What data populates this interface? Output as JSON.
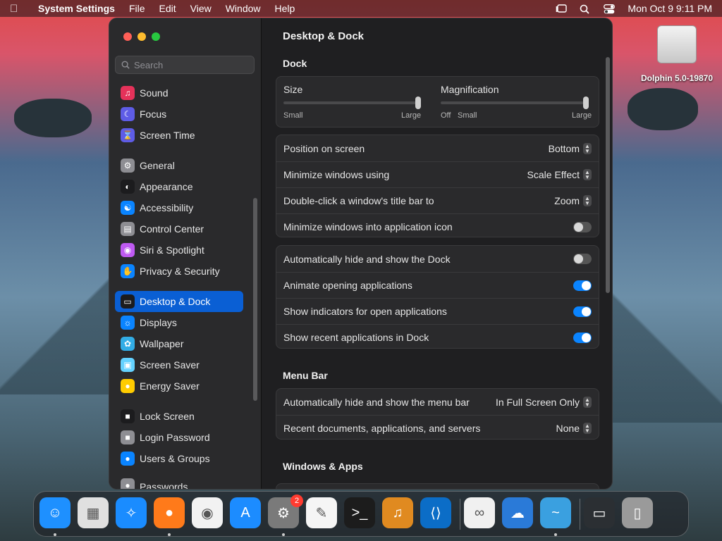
{
  "menubar": {
    "app_name": "System Settings",
    "menus": [
      "File",
      "Edit",
      "View",
      "Window",
      "Help"
    ],
    "clock": "Mon Oct 9  9:11 PM"
  },
  "desktop": {
    "drive_label": "Dolphin 5.0-19870"
  },
  "sidebar": {
    "search_placeholder": "Search",
    "items": [
      {
        "label": "Sound",
        "color": "#e5325a"
      },
      {
        "label": "Focus",
        "color": "#5e5ce6"
      },
      {
        "label": "Screen Time",
        "color": "#5e5ce6"
      },
      {
        "label": "General",
        "color": "#8e8e93"
      },
      {
        "label": "Appearance",
        "color": "#1c1c1e"
      },
      {
        "label": "Accessibility",
        "color": "#0a84ff"
      },
      {
        "label": "Control Center",
        "color": "#8e8e93"
      },
      {
        "label": "Siri & Spotlight",
        "color": "#bf5af2"
      },
      {
        "label": "Privacy & Security",
        "color": "#0a84ff"
      },
      {
        "label": "Desktop & Dock",
        "color": "#1c1c1e"
      },
      {
        "label": "Displays",
        "color": "#0a84ff"
      },
      {
        "label": "Wallpaper",
        "color": "#32ade6"
      },
      {
        "label": "Screen Saver",
        "color": "#64d2ff"
      },
      {
        "label": "Energy Saver",
        "color": "#ffcc00"
      },
      {
        "label": "Lock Screen",
        "color": "#1c1c1e"
      },
      {
        "label": "Login Password",
        "color": "#8e8e93"
      },
      {
        "label": "Users & Groups",
        "color": "#0a84ff"
      },
      {
        "label": "Passwords",
        "color": "#8e8e93"
      }
    ]
  },
  "main": {
    "title": "Desktop & Dock",
    "dock_section": "Dock",
    "size": {
      "label": "Size",
      "min": "Small",
      "max": "Large",
      "value": 1.0
    },
    "magnification": {
      "label": "Magnification",
      "off": "Off",
      "min": "Small",
      "max": "Large",
      "value": 1.0
    },
    "settings": [
      {
        "label": "Position on screen",
        "value": "Bottom"
      },
      {
        "label": "Minimize windows using",
        "value": "Scale Effect"
      },
      {
        "label": "Double-click a window's title bar to",
        "value": "Zoom"
      },
      {
        "label": "Minimize windows into application icon",
        "toggle": false
      }
    ],
    "toggles": [
      {
        "label": "Automatically hide and show the Dock",
        "on": false
      },
      {
        "label": "Animate opening applications",
        "on": true
      },
      {
        "label": "Show indicators for open applications",
        "on": true
      },
      {
        "label": "Show recent applications in Dock",
        "on": true
      }
    ],
    "menubar_section": "Menu Bar",
    "menubar_settings": [
      {
        "label": "Automatically hide and show the menu bar",
        "value": "In Full Screen Only"
      },
      {
        "label": "Recent documents, applications, and servers",
        "value": "None"
      }
    ],
    "windows_section": "Windows & Apps"
  },
  "dock": {
    "apps": [
      {
        "name": "finder-icon",
        "color": "#1e90ff"
      },
      {
        "name": "launchpad-icon",
        "color": "#e0e0e0"
      },
      {
        "name": "safari-icon",
        "color": "#1a8cff"
      },
      {
        "name": "firefox-icon",
        "color": "#ff7a1a"
      },
      {
        "name": "chrome-icon",
        "color": "#f2f2f2"
      },
      {
        "name": "app-store-icon",
        "color": "#1c8cff"
      },
      {
        "name": "system-settings-icon",
        "color": "#7a7a7a",
        "badge": "2"
      },
      {
        "name": "textedit-icon",
        "color": "#f5f5f5"
      },
      {
        "name": "terminal-icon",
        "color": "#1c1c1c"
      },
      {
        "name": "garageband-icon",
        "color": "#e08a20"
      },
      {
        "name": "vscode-icon",
        "color": "#0b6dc7"
      },
      {
        "name": "visual-studio-icon",
        "color": "#f0f0f0"
      },
      {
        "name": "weather-icon",
        "color": "#2a7ad8"
      },
      {
        "name": "dolphin-icon",
        "color": "#3aa0e0"
      },
      {
        "name": "dolphin-window-icon",
        "color": "#2b2f33"
      },
      {
        "name": "trash-icon",
        "color": "#9a9a9a"
      }
    ]
  }
}
